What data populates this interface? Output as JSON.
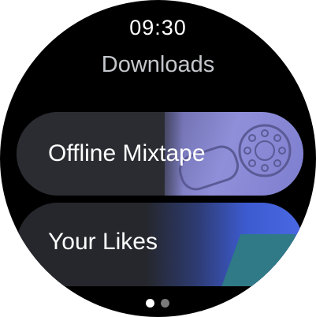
{
  "status_bar": {
    "time": "09:30"
  },
  "header": {
    "title": "Downloads"
  },
  "playlists": [
    {
      "label": "Offline Mixtape",
      "artwork_icon": "rotary-phone-artwork",
      "accent": "#8f8fd9"
    },
    {
      "label": "Your Likes",
      "artwork_icon": "abstract-shapes-artwork",
      "accent": "#4a68e2"
    }
  ],
  "pager": {
    "page_count": 2,
    "current_page": 1
  },
  "colors": {
    "background": "#000000",
    "chip": "#2a2c31",
    "title": "#c4c7cc",
    "text": "#ffffff"
  }
}
